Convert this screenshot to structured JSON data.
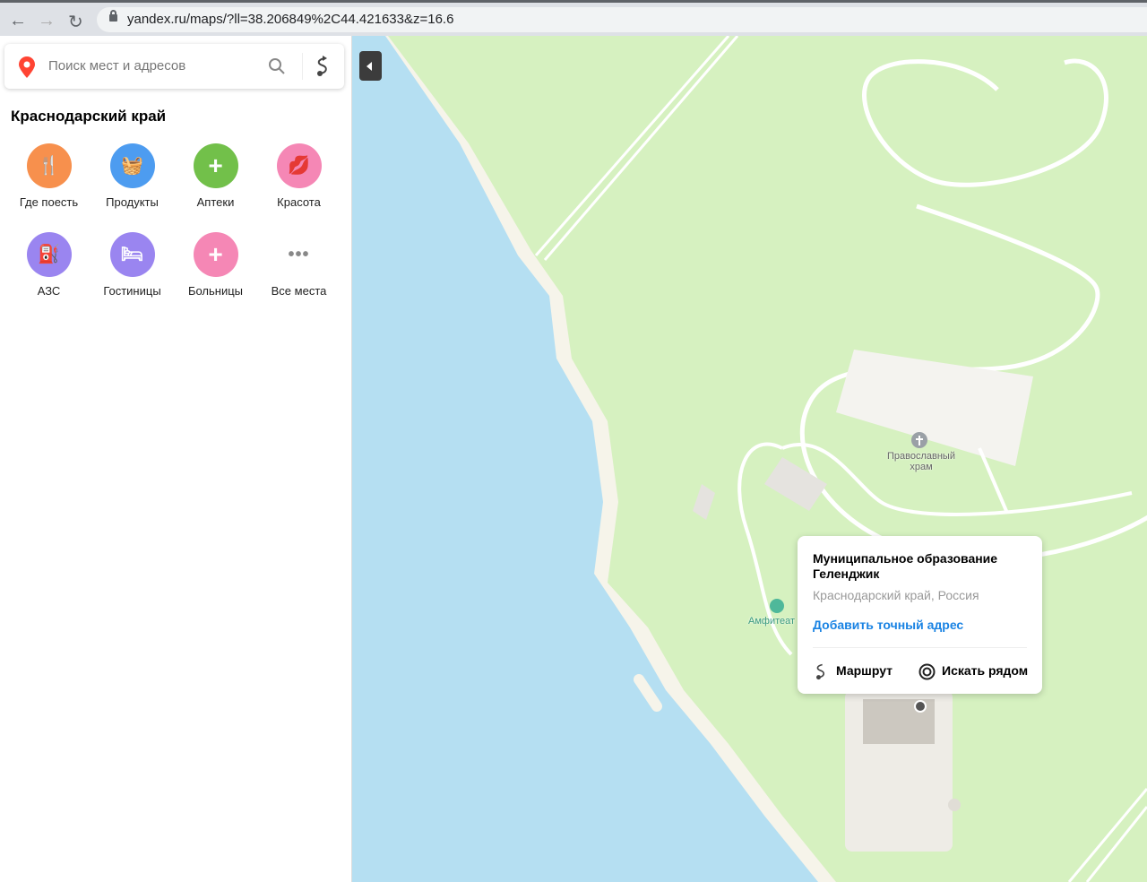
{
  "browser": {
    "url": "yandex.ru/maps/?ll=38.206849%2C44.421633&z=16.6",
    "back_icon": "←",
    "forward_icon": "→",
    "reload_icon": "↻"
  },
  "sidebar": {
    "search_placeholder": "Поиск мест и адресов",
    "region": "Краснодарский край",
    "categories": [
      {
        "label": "Где поесть",
        "color": "#f7904d",
        "icon": "🍴"
      },
      {
        "label": "Продукты",
        "color": "#4d9cf0",
        "icon": "🧺"
      },
      {
        "label": "Аптеки",
        "color": "#72c04a",
        "icon": "+"
      },
      {
        "label": "Красота",
        "color": "#f587b5",
        "icon": "💋"
      },
      {
        "label": "АЗС",
        "color": "#9a85f0",
        "icon": "⛽"
      },
      {
        "label": "Гостиницы",
        "color": "#9a85f0",
        "icon": "🛏"
      },
      {
        "label": "Больницы",
        "color": "#f587b5",
        "icon": "+"
      },
      {
        "label": "Все места",
        "color": "#888888",
        "icon": "•••"
      }
    ]
  },
  "map": {
    "labels": {
      "church": "Православный храм",
      "amphitheatre": "Амфитеат"
    },
    "card": {
      "title": "Муниципальное образование Геленджик",
      "subtitle": "Краснодарский край, Россия",
      "add_address": "Добавить точный адрес",
      "route": "Маршрут",
      "nearby": "Искать рядом"
    }
  }
}
